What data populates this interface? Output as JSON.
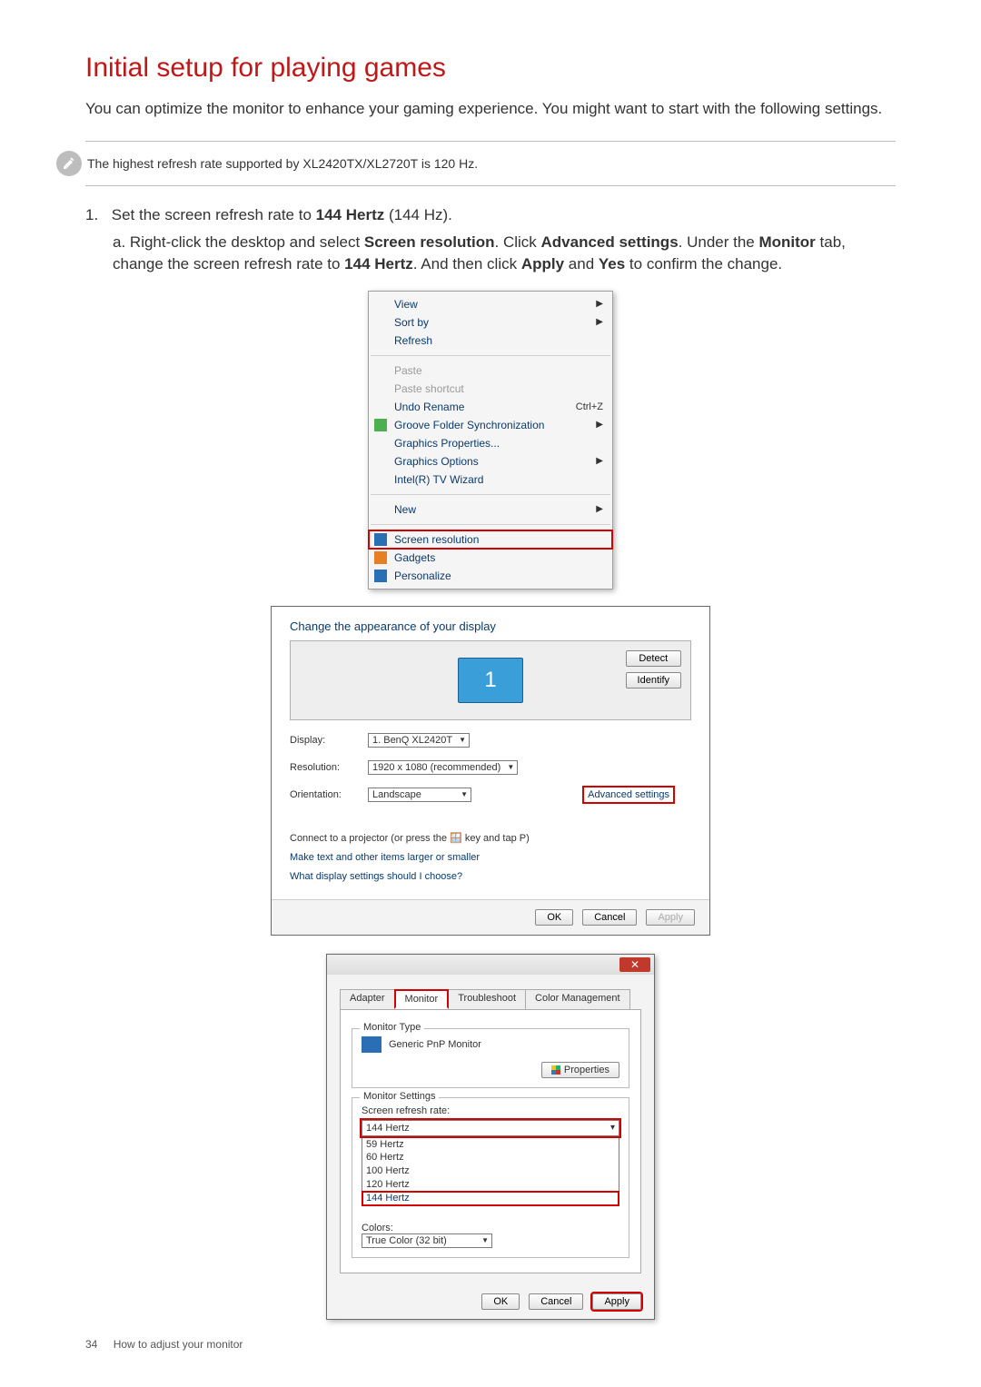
{
  "page": {
    "number": "34",
    "footer": "How to adjust your monitor",
    "title": "Initial setup for playing games",
    "intro": "You can optimize the monitor to enhance your gaming experience. You might want to start with the following settings.",
    "note": "The highest refresh rate supported by XL2420TX/XL2720T is 120 Hz."
  },
  "step": {
    "num": "1.",
    "pre": "Set the screen refresh rate to ",
    "bold1": "144 Hertz",
    "post": " (144 Hz).",
    "sub_letter": "a.",
    "sub_p1": "Right-click the desktop and select ",
    "sub_b1": "Screen resolution",
    "sub_p2": ". Click ",
    "sub_b2": "Advanced settings",
    "sub_p3": ". Under the ",
    "sub_b3": "Monitor",
    "sub_p4": " tab, change the screen refresh rate to ",
    "sub_b4": "144 Hertz",
    "sub_p5": ". And then click ",
    "sub_b5": "Apply",
    "sub_p6": " and ",
    "sub_b6": "Yes",
    "sub_p7": " to confirm the change."
  },
  "ctx": {
    "view": "View",
    "sort": "Sort by",
    "refresh": "Refresh",
    "paste": "Paste",
    "pasteShortcut": "Paste shortcut",
    "undo": "Undo Rename",
    "undoKey": "Ctrl+Z",
    "groove": "Groove Folder Synchronization",
    "gprops": "Graphics Properties...",
    "gopts": "Graphics Options",
    "tvwiz": "Intel(R) TV Wizard",
    "new": "New",
    "screenres": "Screen resolution",
    "gadgets": "Gadgets",
    "personalize": "Personalize"
  },
  "sr": {
    "header": "Change the appearance of your display",
    "detect": "Detect",
    "identify": "Identify",
    "displayLbl": "Display:",
    "displayVal": "1. BenQ XL2420T",
    "resLbl": "Resolution:",
    "resVal": "1920 x 1080 (recommended)",
    "oriLbl": "Orientation:",
    "oriVal": "Landscape",
    "adv": "Advanced settings",
    "proj": "Connect to a projector (or press the 🪟 key and tap P)",
    "makeText": "Make text and other items larger or smaller",
    "whatSettings": "What display settings should I choose?",
    "ok": "OK",
    "cancel": "Cancel",
    "apply": "Apply",
    "monNum": "1"
  },
  "prop": {
    "tabs": {
      "adapter": "Adapter",
      "monitor": "Monitor",
      "trouble": "Troubleshoot",
      "color": "Color Management"
    },
    "monType": "Monitor Type",
    "genericPnp": "Generic PnP Monitor",
    "properties": "Properties",
    "monSettings": "Monitor Settings",
    "rateLbl": "Screen refresh rate:",
    "rateVal": "144 Hertz",
    "rates": [
      "59 Hertz",
      "60 Hertz",
      "100 Hertz",
      "120 Hertz",
      "144 Hertz"
    ],
    "colorsLbl": "Colors:",
    "colorsVal": "True Color (32 bit)",
    "ok": "OK",
    "cancel": "Cancel",
    "apply": "Apply",
    "closeX": "✕"
  }
}
